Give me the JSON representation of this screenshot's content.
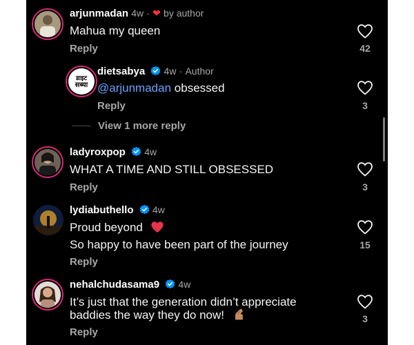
{
  "comments": [
    {
      "username": "arjunmadan",
      "time": "4w",
      "author_note": "by author",
      "text": "Mahua my queen",
      "reply_label": "Reply",
      "likes": "42"
    },
    {
      "username": "dietsabya",
      "time": "4w",
      "author_note": "Author",
      "mention": "@arjunmadan",
      "text": "obsessed",
      "reply_label": "Reply",
      "likes": "3",
      "avatar_text_1": "डाइट",
      "avatar_text_2": "सब्या"
    },
    {
      "username": "ladyroxpop",
      "time": "4w",
      "text": "WHAT A TIME AND STILL OBSESSED",
      "reply_label": "Reply",
      "likes": "3"
    },
    {
      "username": "lydiabuthello",
      "time": "4w",
      "text_line1": "Proud beyond",
      "text_line2": "So happy to have been part of the journey",
      "reply_label": "Reply",
      "likes": "15"
    },
    {
      "username": "nehalchudasama9",
      "time": "4w",
      "text_line1": "It’s just that the generation didn’t appreciate",
      "text_line2": "baddies the way they do now!",
      "reply_label": "Reply",
      "likes": "3"
    }
  ],
  "view_more_replies": "View 1 more reply",
  "colors": {
    "background": "#000000",
    "text": "#f5f5f5",
    "muted": "#a8a8a8",
    "mention": "#6aa3ff",
    "verified": "#0095f6",
    "heart_red": "#ff3040"
  }
}
